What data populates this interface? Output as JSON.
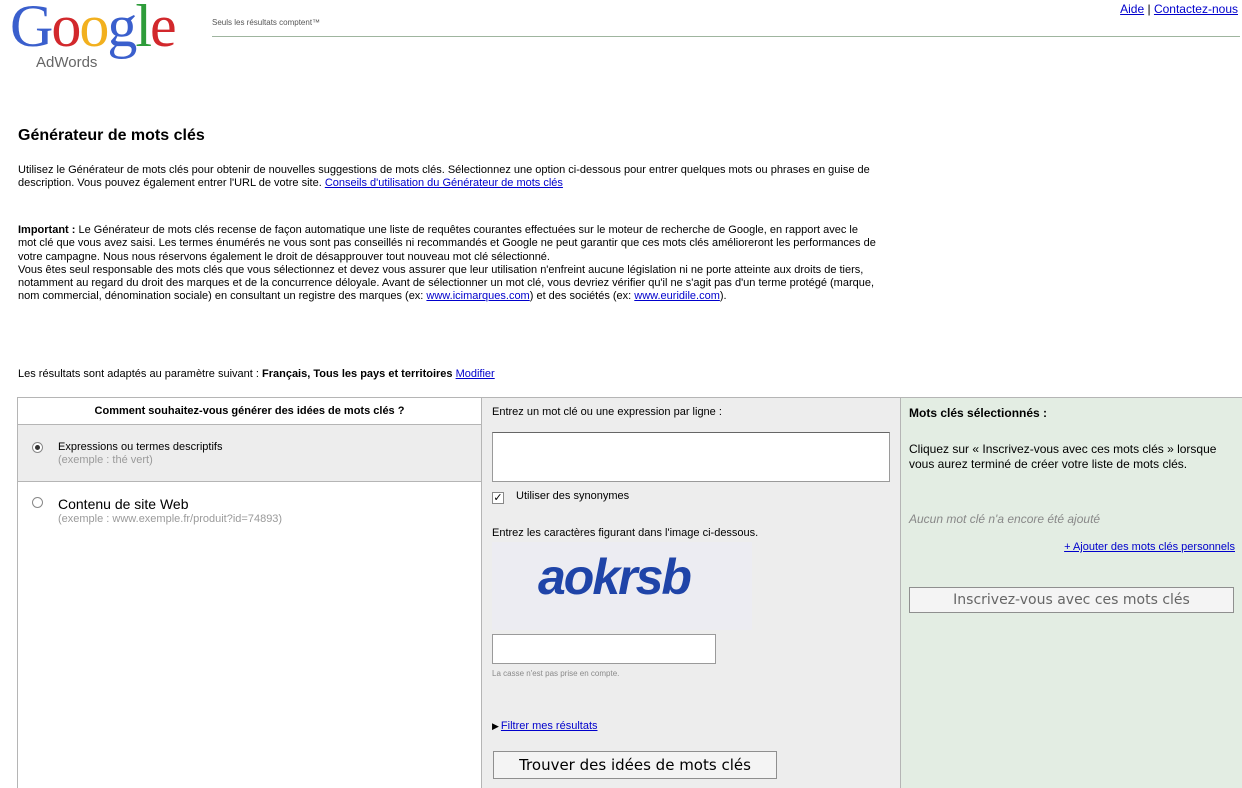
{
  "header": {
    "logo_word": [
      "G",
      "o",
      "o",
      "g",
      "l",
      "e"
    ],
    "logo_colors": [
      "#3a5fcd",
      "#d2282c",
      "#f2b01e",
      "#3a5fcd",
      "#2e9c3a",
      "#d2282c"
    ],
    "logo_sub": "AdWords",
    "tagline": "Seuls les résultats comptent™",
    "links": {
      "help": "Aide",
      "separator": "|",
      "contact": "Contactez-nous"
    }
  },
  "page_title": "Générateur de mots clés",
  "intro": {
    "text": "Utilisez le Générateur de mots clés pour obtenir de nouvelles suggestions de mots clés. Sélectionnez une option ci-dessous pour entrer quelques mots ou phrases en guise de description. Vous pouvez également entrer l'URL de votre site. ",
    "link": "Conseils d'utilisation du Générateur de mots clés"
  },
  "important": {
    "label": "Important :",
    "text1": " Le Générateur de mots clés recense de façon automatique une liste de requêtes courantes effectuées sur le moteur de recherche de Google, en rapport avec le mot clé que vous avez saisi. Les termes énumérés ne vous sont pas conseillés ni recommandés et Google ne peut garantir que ces mots clés amélioreront les performances de votre campagne. Nous nous réservons également le droit de désapprouver tout nouveau mot clé sélectionné.",
    "text2": "Vous êtes seul responsable des mots clés que vous sélectionnez et devez vous assurer que leur utilisation n'enfreint aucune législation ni ne porte atteinte aux droits de tiers, notamment au regard du droit des marques et de la concurrence déloyale. Avant de sélectionner un mot clé, vous devriez vérifier qu'il ne s'agit pas d'un terme protégé (marque, nom commercial, dénomination sociale) en consultant un registre des marques (ex: ",
    "link1": "www.icimarques.com",
    "text3": ") et des sociétés (ex: ",
    "link2": "www.euridile.com",
    "text4": ")."
  },
  "settings": {
    "prefix": "Les résultats sont adaptés au paramètre suivant : ",
    "value": "Français, Tous les pays et territoires",
    "modify": "Modifier"
  },
  "left": {
    "heading": "Comment souhaitez-vous générer des idées de mots clés ?",
    "options": [
      {
        "label": "Expressions ou termes descriptifs",
        "example": "(exemple : thé vert)",
        "selected": true
      },
      {
        "label": "Contenu de site Web",
        "example": "(exemple : www.exemple.fr/produit?id=74893)",
        "selected": false
      }
    ]
  },
  "middle": {
    "heading": "Entrez un mot clé ou une expression par ligne :",
    "keywords_value": "",
    "synonyms_label": "Utiliser des synonymes",
    "synonyms_checked": "✓",
    "captcha_instruction": "Entrez les caractères figurant dans l'image ci-dessous.",
    "captcha_text": "aokrsb",
    "captcha_value": "",
    "case_note": "La casse n'est pas prise en compte.",
    "filter_arrow": "▶",
    "filter_link": "Filtrer mes résultats",
    "find_button": "Trouver des idées de mots clés"
  },
  "right": {
    "heading": "Mots clés sélectionnés :",
    "instructions": "Cliquez sur « Inscrivez-vous avec ces mots clés » lorsque vous aurez terminé de créer votre liste de mots clés.",
    "empty": "Aucun mot clé n'a encore été ajouté",
    "add_link": "+ Ajouter des mots clés personnels",
    "signup_button": "Inscrivez-vous avec ces mots clés"
  }
}
